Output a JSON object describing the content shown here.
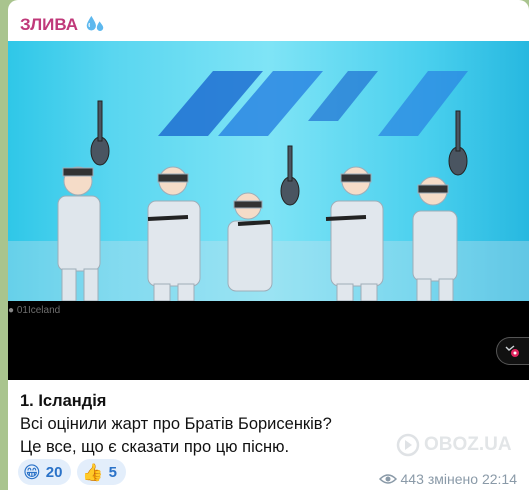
{
  "channel": {
    "title": "ЗЛИВА",
    "icon": "sweat-droplets-icon"
  },
  "media": {
    "watermark": "01Iceland",
    "more_icon": "video-menu-icon",
    "colors": {
      "stage": "#2fc7e8",
      "letterbox": "#000000"
    }
  },
  "caption": {
    "line1": "1. Ісландія",
    "line2": "Всі оцінили жарт про Братів Борисенків?",
    "line3": "Це все, що є сказати про цю пісню."
  },
  "reactions": [
    {
      "emoji": "😁",
      "count": "20"
    },
    {
      "emoji": "👍",
      "count": "5"
    }
  ],
  "meta": {
    "views": "443",
    "edited_time": "змінено 22:14",
    "views_icon": "eye-icon"
  },
  "watermark_site": "OBOZ.UA",
  "colors": {
    "title": "#c0397a",
    "reaction_bg": "#e3eefb",
    "reaction_text": "#2a72c8",
    "meta_text": "#8a9aa8"
  }
}
